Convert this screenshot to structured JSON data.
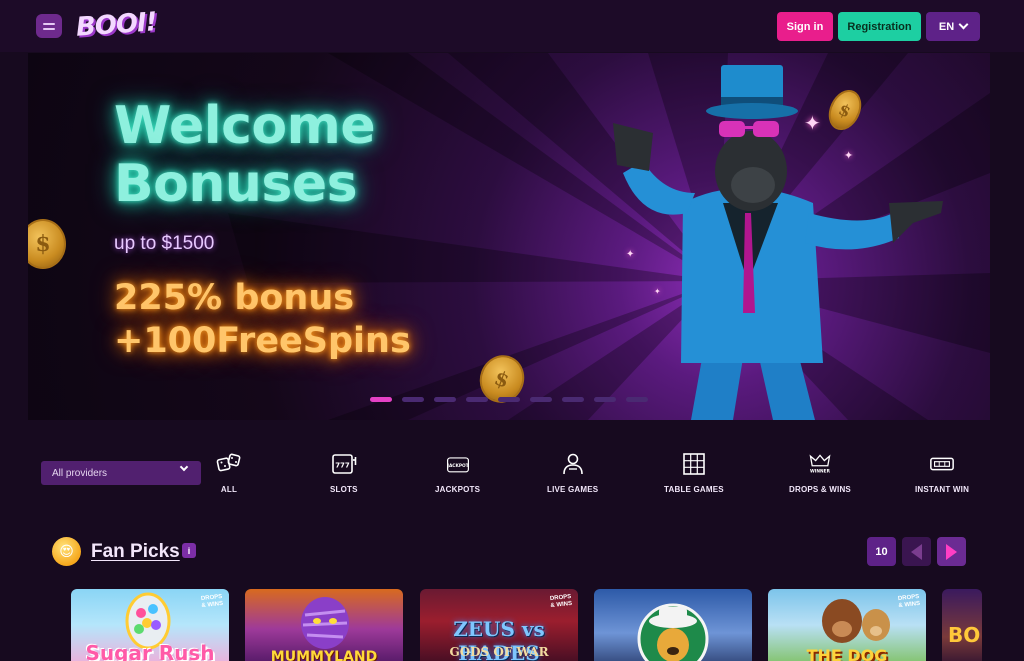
{
  "header": {
    "logo": "BOOI!",
    "signin_label": "Sign in",
    "register_label": "Registration",
    "lang_label": "EN"
  },
  "banner": {
    "title_line1": "Welcome",
    "title_line2": "Bonuses",
    "subtitle": "up to $1500",
    "offer_line1": "225% bonus",
    "offer_line2": "+100FreeSpins",
    "slides_total": 9,
    "active_slide": 1
  },
  "filters": {
    "providers_label": "All providers",
    "categories": [
      {
        "label": "ALL",
        "icon": "dice-icon"
      },
      {
        "label": "SLOTS",
        "icon": "slot-machine-icon"
      },
      {
        "label": "JACKPOTS",
        "icon": "jackpot-icon"
      },
      {
        "label": "LIVE GAMES",
        "icon": "live-dealer-icon"
      },
      {
        "label": "TABLE GAMES",
        "icon": "table-grid-icon"
      },
      {
        "label": "DROPS & WINS",
        "icon": "crown-winner-icon"
      },
      {
        "label": "INSTANT WIN",
        "icon": "instant-ticket-icon"
      }
    ],
    "jackpot_icon_text": "JACKPOT",
    "winner_icon_text": "WINNER",
    "slots_icon_text": "777"
  },
  "fan_picks": {
    "emoji": "😍",
    "title": "Fan Picks",
    "info": "i",
    "count": "10",
    "games": [
      {
        "title": "Sugar Rush",
        "tag": "DROPS & WINS"
      },
      {
        "title": "MUMMYLAND",
        "tag": ""
      },
      {
        "title": "ZEUS vs HADES",
        "subtitle": "GODS OF WAR",
        "tag": "DROPS & WINS"
      },
      {
        "title": "",
        "tag": ""
      },
      {
        "title": "THE DOG",
        "tag": "DROPS & WINS"
      },
      {
        "title": "BO",
        "tag": ""
      }
    ]
  },
  "colors": {
    "background": "#170a1f",
    "signin": "#e91e8c",
    "register": "#1dcfa2",
    "lang": "#5e2288",
    "neon_title": "#8ef0de",
    "neon_offer": "#ffc56a"
  }
}
